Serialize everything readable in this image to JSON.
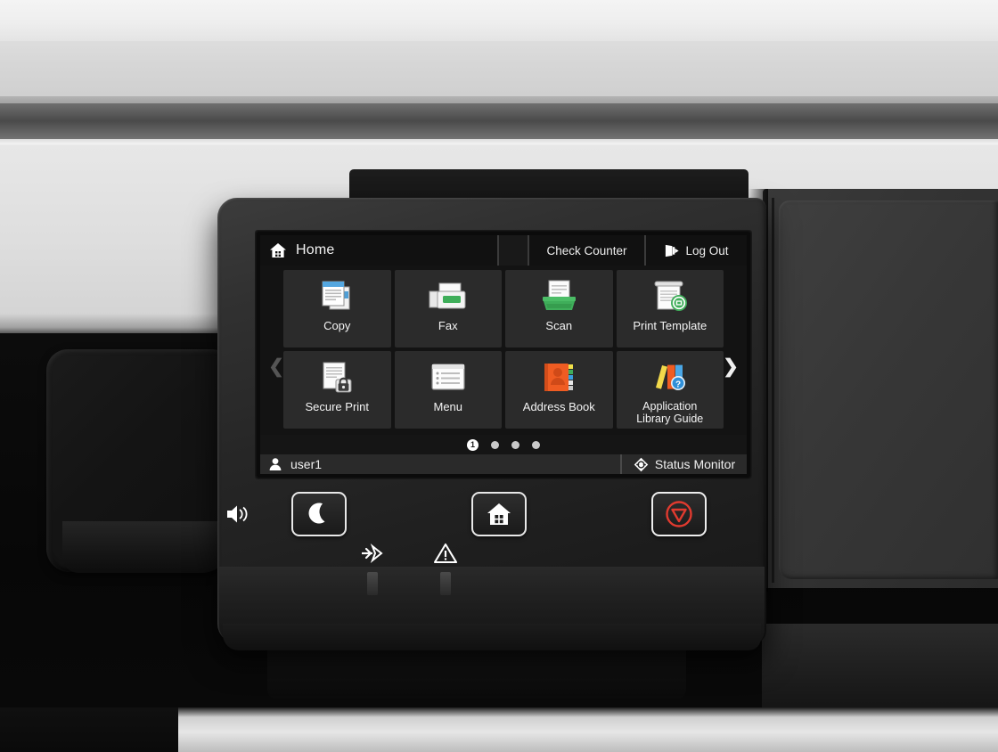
{
  "device": {
    "name": "multifunction-printer-control-panel",
    "accent_green": "#3fae5a",
    "accent_orange": "#ef5c22",
    "accent_blue": "#3a9fe0",
    "accent_red": "#e03a2f",
    "screen_bg": "#131313"
  },
  "screen": {
    "topbar": {
      "home_label": "Home",
      "home_icon": "home-icon",
      "check_counter_label": "Check Counter",
      "logout_label": "Log Out",
      "logout_icon": "logout-icon"
    },
    "nav": {
      "prev_icon": "chevron-left-icon",
      "next_icon": "chevron-right-icon",
      "prev_enabled": "false",
      "next_enabled": "true"
    },
    "tiles": [
      {
        "label": "Copy",
        "icon": "copy-icon"
      },
      {
        "label": "Fax",
        "icon": "fax-icon"
      },
      {
        "label": "Scan",
        "icon": "scan-icon"
      },
      {
        "label": "Print Template",
        "icon": "print-template-icon"
      },
      {
        "label": "Secure Print",
        "icon": "secure-print-icon"
      },
      {
        "label": "Menu",
        "icon": "menu-icon"
      },
      {
        "label": "Address Book",
        "icon": "address-book-icon"
      },
      {
        "label": "Application\nLibrary Guide",
        "label_line1": "Application",
        "label_line2": "Library Guide",
        "icon": "application-library-guide-icon"
      }
    ],
    "pager": {
      "current_page": "1",
      "total_pages": 4,
      "dots": [
        "1",
        "",
        "",
        ""
      ]
    },
    "statusbar": {
      "user_icon": "user-icon",
      "user_name": "user1",
      "status_monitor_label": "Status Monitor",
      "status_monitor_icon": "status-monitor-icon"
    }
  },
  "hardware": {
    "speaker_icon": "speaker-volume-icon",
    "buttons": [
      {
        "name": "sleep-button",
        "icon": "moon-icon"
      },
      {
        "name": "home-button",
        "icon": "home-icon"
      },
      {
        "name": "stop-button",
        "icon": "stop-icon"
      }
    ],
    "leds": [
      {
        "name": "data-led",
        "icon": "data-arrow-icon"
      },
      {
        "name": "error-led",
        "icon": "warning-triangle-icon"
      }
    ]
  }
}
